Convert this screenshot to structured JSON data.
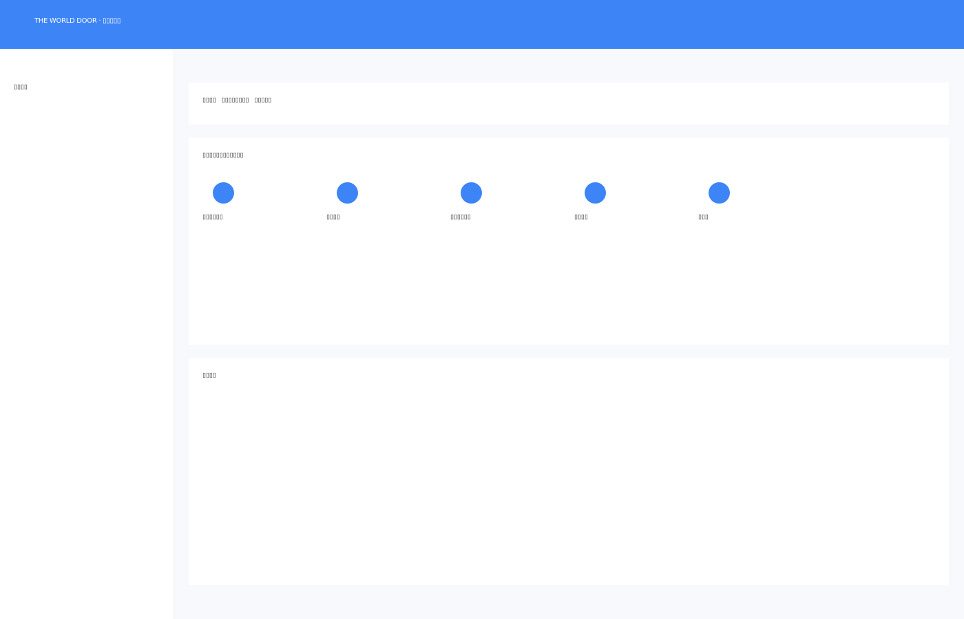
{
  "header": {
    "title": "THE WORLD DOOR · ▯▯▯▯▯"
  },
  "sidebar": {
    "label": "▯▯▯▯"
  },
  "nav": {
    "links": [
      "▯▯▯▯",
      "▯▯▯▯▯▯▯▯",
      "▯▯▯▯▯"
    ]
  },
  "apps_panel": {
    "heading": "▯▯▯▯▯▯▯▯▯▯▯▯",
    "items": [
      {
        "label": "▯▯▯▯▯▯",
        "icon": "app-icon"
      },
      {
        "label": "▯▯▯▯",
        "icon": "app-icon"
      },
      {
        "label": "▯▯▯▯▯▯",
        "icon": "app-icon"
      },
      {
        "label": "▯▯▯▯",
        "icon": "app-icon"
      },
      {
        "label": "▯▯▯",
        "icon": "app-icon"
      }
    ]
  },
  "recent_panel": {
    "heading": "▯▯▯▯"
  },
  "colors": {
    "accent": "#3d84f6",
    "page_bg": "#f7f9fc",
    "panel_bg": "#ffffff"
  }
}
